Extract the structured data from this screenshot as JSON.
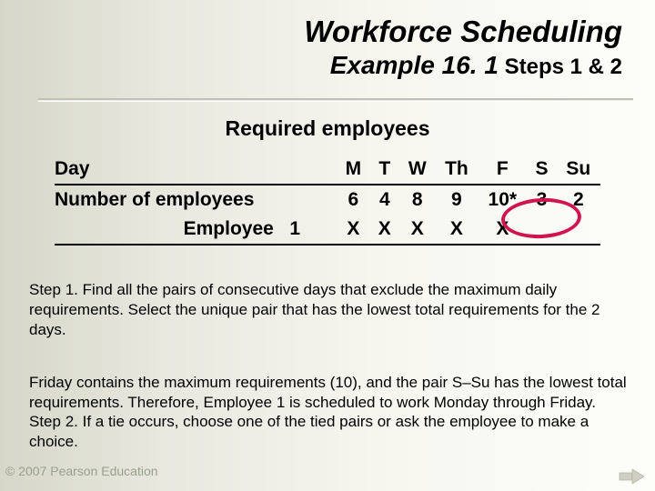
{
  "title": {
    "line1": "Workforce Scheduling",
    "line2_em": "Example 16. 1",
    "line2_small": " Steps 1 & 2"
  },
  "subhead": "Required employees",
  "table": {
    "row_header_label": "Day",
    "days": [
      "M",
      "T",
      "W",
      "Th",
      "F",
      "S",
      "Su"
    ],
    "num_label": "Number of employees",
    "values": [
      "6",
      "4",
      "8",
      "9",
      "10*",
      "3",
      "2"
    ],
    "emp_label": "Employee   1",
    "marks": [
      "X",
      "X",
      "X",
      "X",
      "X",
      "",
      ""
    ]
  },
  "paragraphs": {
    "step1": "Step 1. Find all the pairs of consecutive days that exclude the maximum daily requirements. Select the unique pair that has the lowest total requirements for the 2 days.",
    "step2": "Friday contains the maximum requirements (10), and the pair S–Su has the lowest total requirements. Therefore, Employee 1 is scheduled to work Monday through Friday.\nStep 2. If a tie occurs, choose one of the tied pairs or ask the employee to make a choice."
  },
  "copyright": "© 2007 Pearson Education",
  "icons": {
    "next": "next-arrow-icon"
  }
}
